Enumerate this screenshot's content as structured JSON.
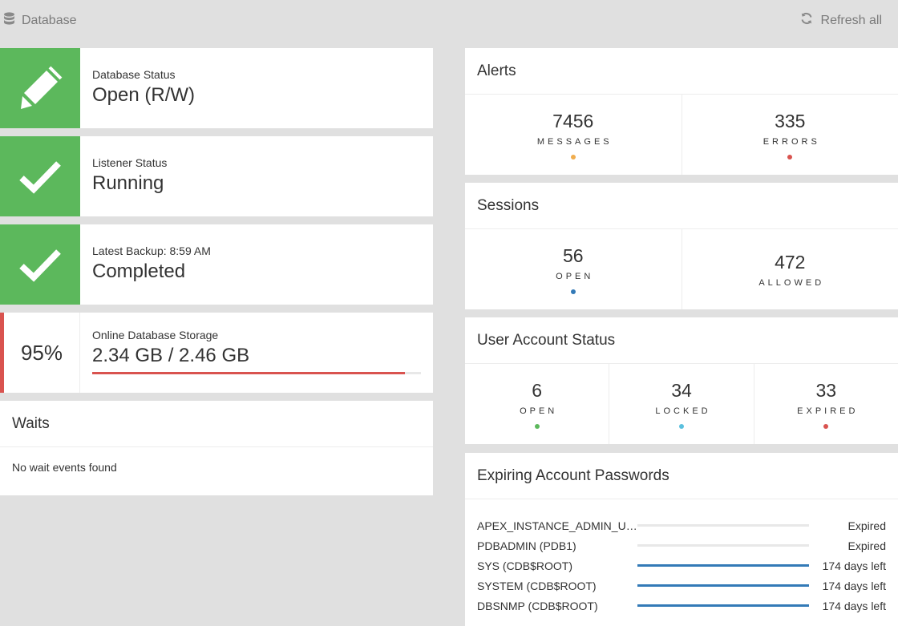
{
  "breadcrumb": {
    "label": "Database"
  },
  "actions": {
    "refresh_label": "Refresh all"
  },
  "status_cards": [
    {
      "label": "Database Status",
      "value": "Open (R/W)",
      "icon": "pencil-icon"
    },
    {
      "label": "Listener Status",
      "value": "Running",
      "icon": "check-icon"
    },
    {
      "label": "Latest Backup: 8:59 AM",
      "value": "Completed",
      "icon": "check-icon"
    }
  ],
  "storage": {
    "percent_label": "95%",
    "label": "Online Database Storage",
    "value": "2.34 GB / 2.46 GB",
    "fill_fraction": 0.95,
    "color": "#d9534f"
  },
  "waits": {
    "title": "Waits",
    "message": "No wait events found"
  },
  "alerts": {
    "title": "Alerts",
    "metrics": [
      {
        "value": "7456",
        "label": "MESSAGES",
        "color": "#f0ad4e"
      },
      {
        "value": "335",
        "label": "ERRORS",
        "color": "#d9534f"
      }
    ]
  },
  "sessions": {
    "title": "Sessions",
    "metrics": [
      {
        "value": "56",
        "label": "OPEN",
        "color": "#337ab7"
      },
      {
        "value": "472",
        "label": "ALLOWED"
      }
    ]
  },
  "user_accounts": {
    "title": "User Account Status",
    "metrics": [
      {
        "value": "6",
        "label": "OPEN",
        "color": "#5cb85c"
      },
      {
        "value": "34",
        "label": "LOCKED",
        "color": "#5bc0de"
      },
      {
        "value": "33",
        "label": "EXPIRED",
        "color": "#d9534f"
      }
    ]
  },
  "expiring_passwords": {
    "title": "Expiring Account Passwords",
    "rows": [
      {
        "name": "APEX_INSTANCE_ADMIN_USER",
        "value": "Expired",
        "fill_fraction": 0
      },
      {
        "name": "PDBADMIN (PDB1)",
        "value": "Expired",
        "fill_fraction": 0
      },
      {
        "name": "SYS (CDB$ROOT)",
        "value": "174 days left",
        "fill_fraction": 1
      },
      {
        "name": "SYSTEM (CDB$ROOT)",
        "value": "174 days left",
        "fill_fraction": 1
      },
      {
        "name": "DBSNMP (CDB$ROOT)",
        "value": "174 days left",
        "fill_fraction": 1
      }
    ]
  },
  "colors": {
    "success": "#5cb85c",
    "danger": "#d9534f",
    "primary": "#337ab7",
    "background": "#e0e0e0"
  }
}
